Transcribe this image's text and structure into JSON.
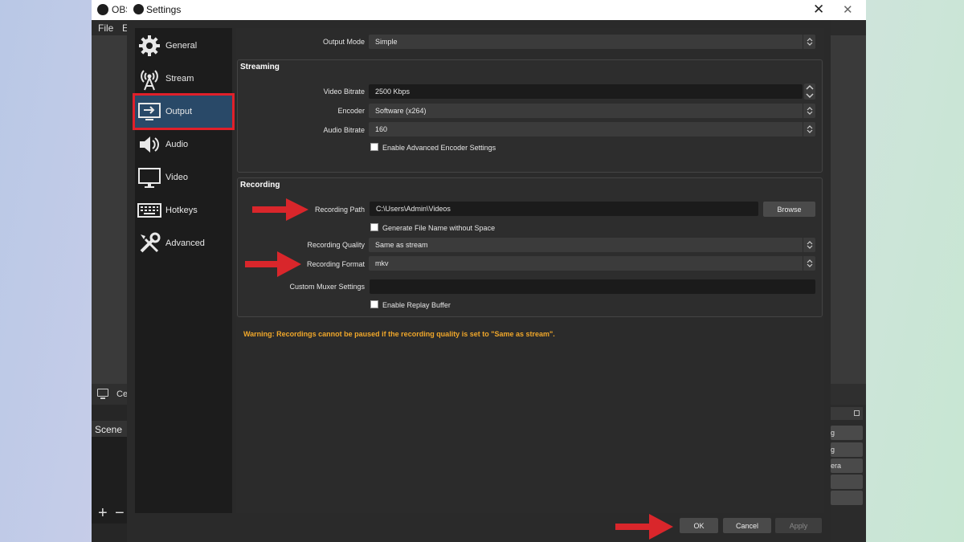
{
  "obs_window": {
    "title": "OBS",
    "menu": [
      "File",
      "E"
    ],
    "source_label": "Cel",
    "scenes_label": "Scene",
    "add_symbol": "+",
    "remove_symbol": "−",
    "right_controls": [
      "g",
      "g",
      "era",
      "",
      ""
    ]
  },
  "settings": {
    "title": "Settings",
    "sidebar": [
      {
        "label": "General",
        "icon": "gear-icon"
      },
      {
        "label": "Stream",
        "icon": "broadcast-tower-icon"
      },
      {
        "label": "Output",
        "icon": "output-monitor-icon",
        "selected": true
      },
      {
        "label": "Audio",
        "icon": "speaker-icon"
      },
      {
        "label": "Video",
        "icon": "monitor-icon"
      },
      {
        "label": "Hotkeys",
        "icon": "keyboard-icon"
      },
      {
        "label": "Advanced",
        "icon": "tools-icon"
      }
    ],
    "output_mode": {
      "label": "Output Mode",
      "value": "Simple"
    },
    "streaming": {
      "title": "Streaming",
      "video_bitrate": {
        "label": "Video Bitrate",
        "value": "2500 Kbps"
      },
      "encoder": {
        "label": "Encoder",
        "value": "Software (x264)"
      },
      "audio_bitrate": {
        "label": "Audio Bitrate",
        "value": "160"
      },
      "advanced_encoder": {
        "label": "Enable Advanced Encoder Settings",
        "checked": false
      }
    },
    "recording": {
      "title": "Recording",
      "path": {
        "label": "Recording Path",
        "value": "C:\\Users\\Admin\\Videos"
      },
      "browse_label": "Browse",
      "no_space": {
        "label": "Generate File Name without Space",
        "checked": false
      },
      "quality": {
        "label": "Recording Quality",
        "value": "Same as stream"
      },
      "format": {
        "label": "Recording Format",
        "value": "mkv"
      },
      "muxer": {
        "label": "Custom Muxer Settings",
        "value": ""
      },
      "replay_buffer": {
        "label": "Enable Replay Buffer",
        "checked": false
      }
    },
    "warning": "Warning: Recordings cannot be paused if the recording quality is set to \"Same as stream\".",
    "buttons": {
      "ok": "OK",
      "cancel": "Cancel",
      "apply": "Apply"
    },
    "colors": {
      "highlight_outline": "#e0202a",
      "warning": "#f0a72a",
      "selected_bg": "#294968",
      "arrow": "#d9262b"
    }
  }
}
